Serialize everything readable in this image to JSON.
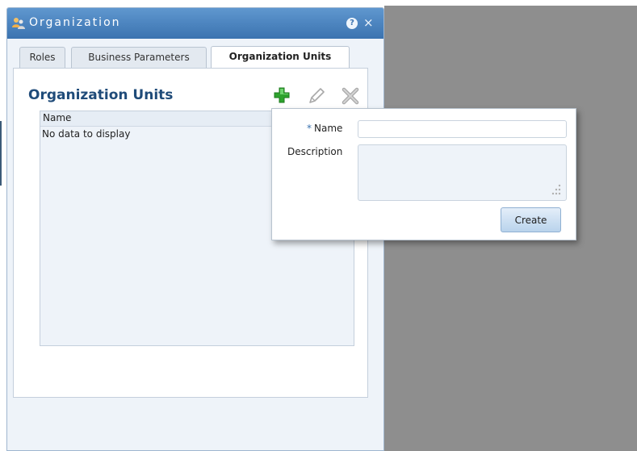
{
  "window": {
    "title": "Organization",
    "icons": {
      "title": "users-icon",
      "help": "help-icon",
      "close": "close-icon"
    },
    "help_glyph": "?",
    "close_glyph": "×"
  },
  "tabs": [
    {
      "label": "Roles",
      "active": false
    },
    {
      "label": "Business Parameters",
      "active": false
    },
    {
      "label": "Organization Units",
      "active": true
    }
  ],
  "section": {
    "title": "Organization Units",
    "toolbar": {
      "add": "add-icon",
      "edit": "edit-icon",
      "delete": "delete-icon"
    }
  },
  "table": {
    "columns": [
      "Name"
    ],
    "rows": [],
    "empty_message": "No data to display"
  },
  "create_popup": {
    "name_label": "Name",
    "required_marker": "*",
    "name_value": "",
    "description_label": "Description",
    "description_value": "",
    "create_label": "Create"
  },
  "colors": {
    "titlebar": "#3b73b0",
    "section_title": "#1f4b79",
    "background_gray": "#8e8e8e",
    "add_green": "#2ea32e"
  }
}
